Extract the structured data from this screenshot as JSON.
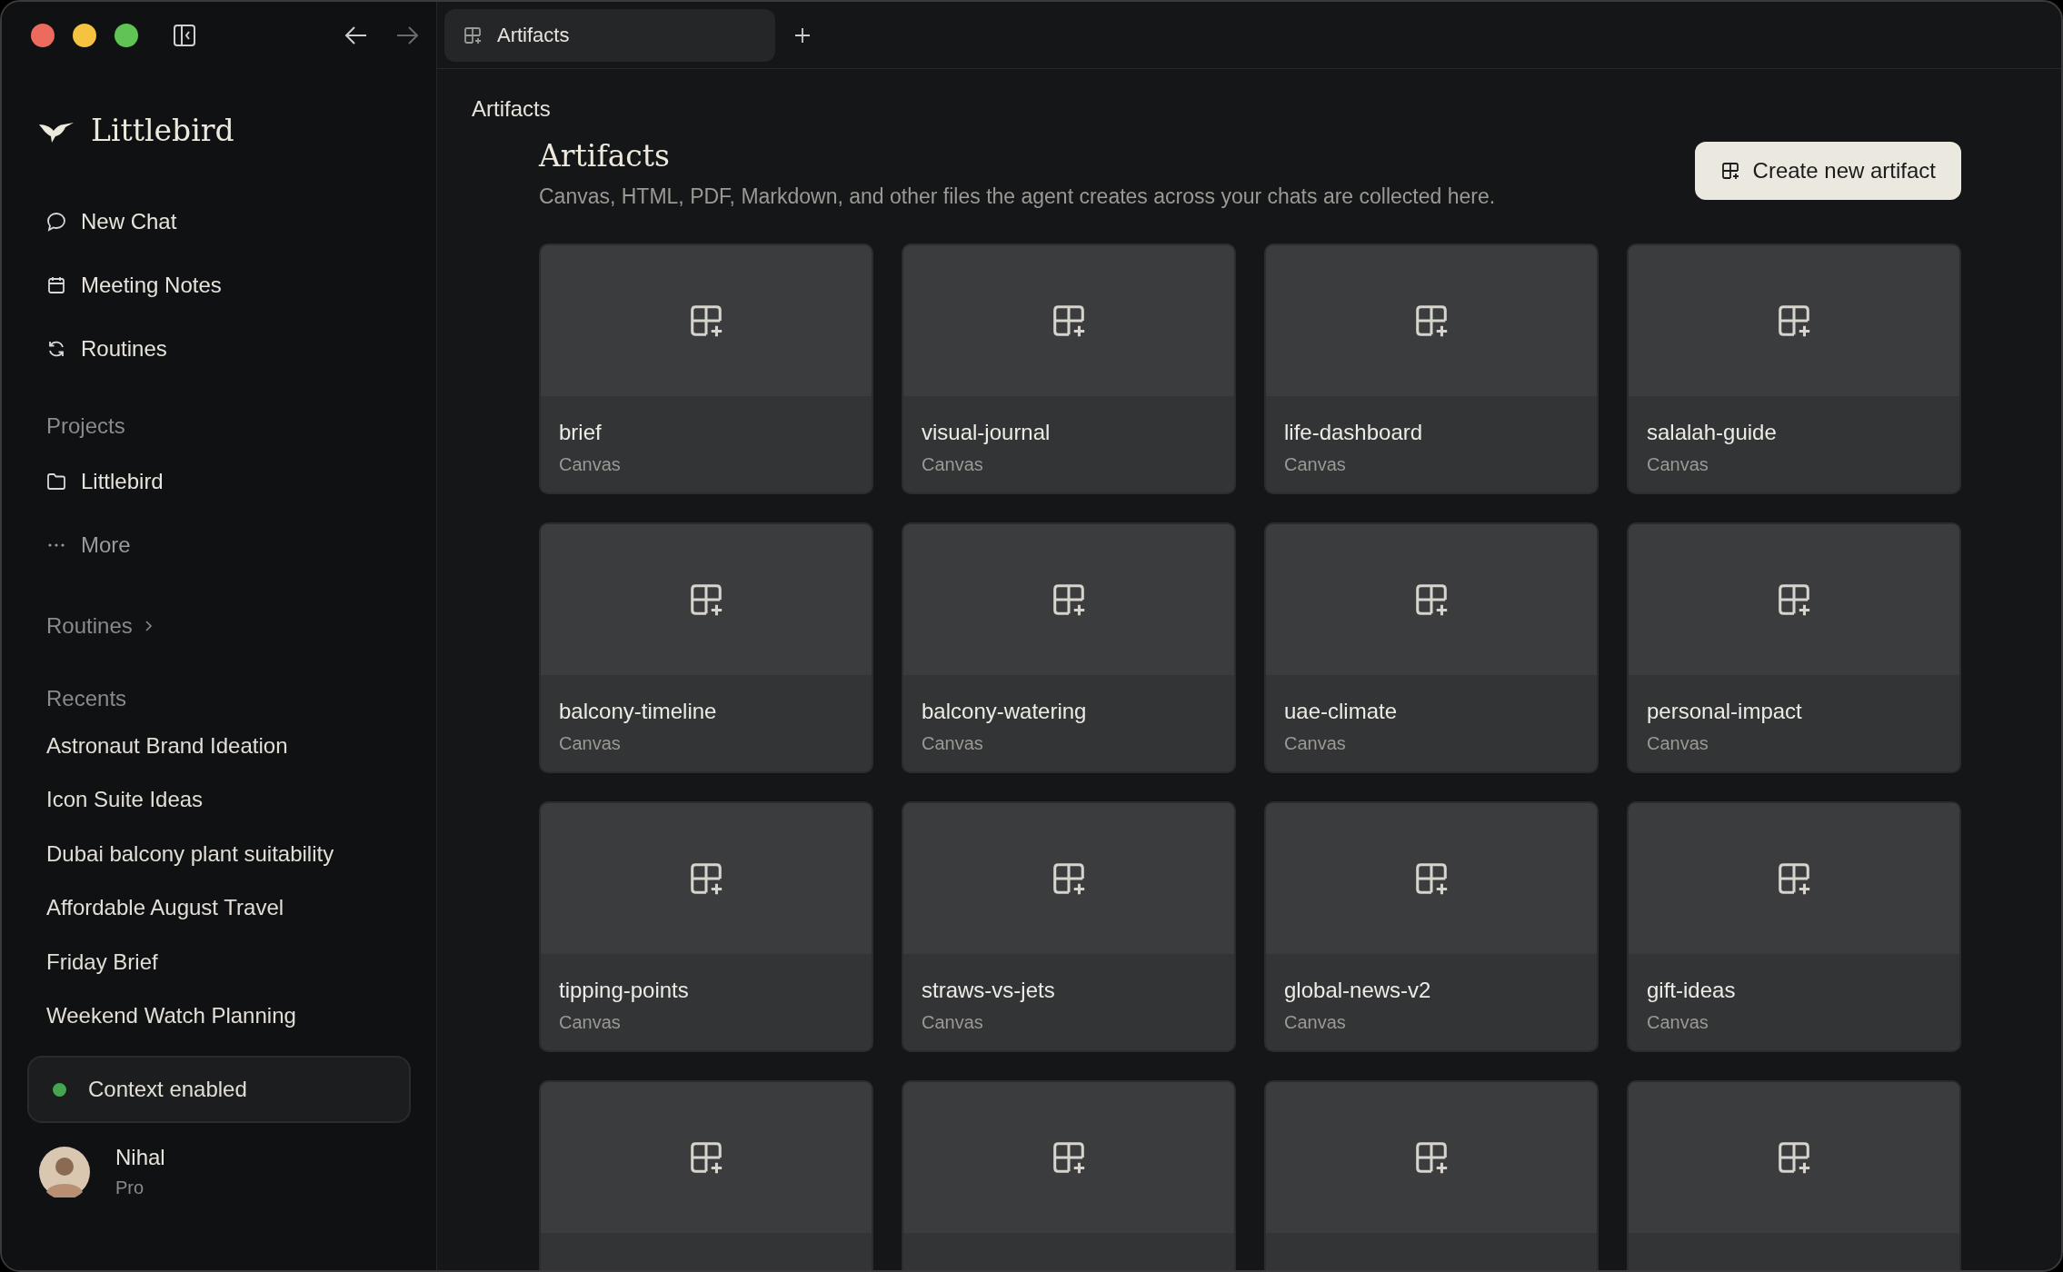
{
  "nav": {
    "back_disabled": false,
    "forward_disabled": true
  },
  "tabs": [
    {
      "label": "Artifacts",
      "selected": true
    }
  ],
  "app": {
    "name": "Littlebird"
  },
  "sidebar": {
    "items": [
      {
        "label": "New Chat",
        "kind": "chat"
      },
      {
        "label": "Meeting Notes",
        "kind": "calendar"
      },
      {
        "label": "Routines",
        "kind": "refresh"
      }
    ],
    "projects": {
      "heading": "Projects",
      "items": [
        {
          "label": "Littlebird",
          "kind": "folder"
        },
        {
          "label": "More",
          "kind": "more"
        }
      ]
    },
    "routines": {
      "heading": "Routines"
    },
    "recents": {
      "heading": "Recents",
      "items": [
        "Astronaut Brand Ideation",
        "Icon Suite Ideas",
        "Dubai balcony plant suitability",
        "Affordable August Travel",
        "Friday Brief",
        "Weekend Watch Planning"
      ]
    },
    "status": {
      "label": "Context enabled",
      "color": "#45a552"
    },
    "user": {
      "name": "Nihal",
      "plan": "Pro"
    }
  },
  "breadcrumb": "Artifacts",
  "page": {
    "title": "Artifacts",
    "description": "Canvas, HTML, PDF, Markdown, and other files the agent creates across your chats are collected here.",
    "button": "Create new artifact"
  },
  "cards": [
    {
      "name": "brief",
      "type": "Canvas",
      "kind": "canvas"
    },
    {
      "name": "visual-journal",
      "type": "Canvas",
      "kind": "canvas"
    },
    {
      "name": "life-dashboard",
      "type": "Canvas",
      "kind": "canvas"
    },
    {
      "name": "salalah-guide",
      "type": "Canvas",
      "kind": "canvas"
    },
    {
      "name": "balcony-timeline",
      "type": "Canvas",
      "kind": "canvas"
    },
    {
      "name": "balcony-watering",
      "type": "Canvas",
      "kind": "canvas"
    },
    {
      "name": "uae-climate",
      "type": "Canvas",
      "kind": "canvas"
    },
    {
      "name": "personal-impact",
      "type": "Canvas",
      "kind": "canvas"
    },
    {
      "name": "tipping-points",
      "type": "Canvas",
      "kind": "canvas"
    },
    {
      "name": "straws-vs-jets",
      "type": "Canvas",
      "kind": "canvas"
    },
    {
      "name": "global-news-v2",
      "type": "Canvas",
      "kind": "canvas"
    },
    {
      "name": "gift-ideas",
      "type": "Canvas",
      "kind": "canvas"
    },
    {
      "kind": "canvas"
    },
    {
      "kind": "canvas"
    },
    {
      "kind": "canvas"
    },
    {
      "kind": "canvas"
    }
  ]
}
